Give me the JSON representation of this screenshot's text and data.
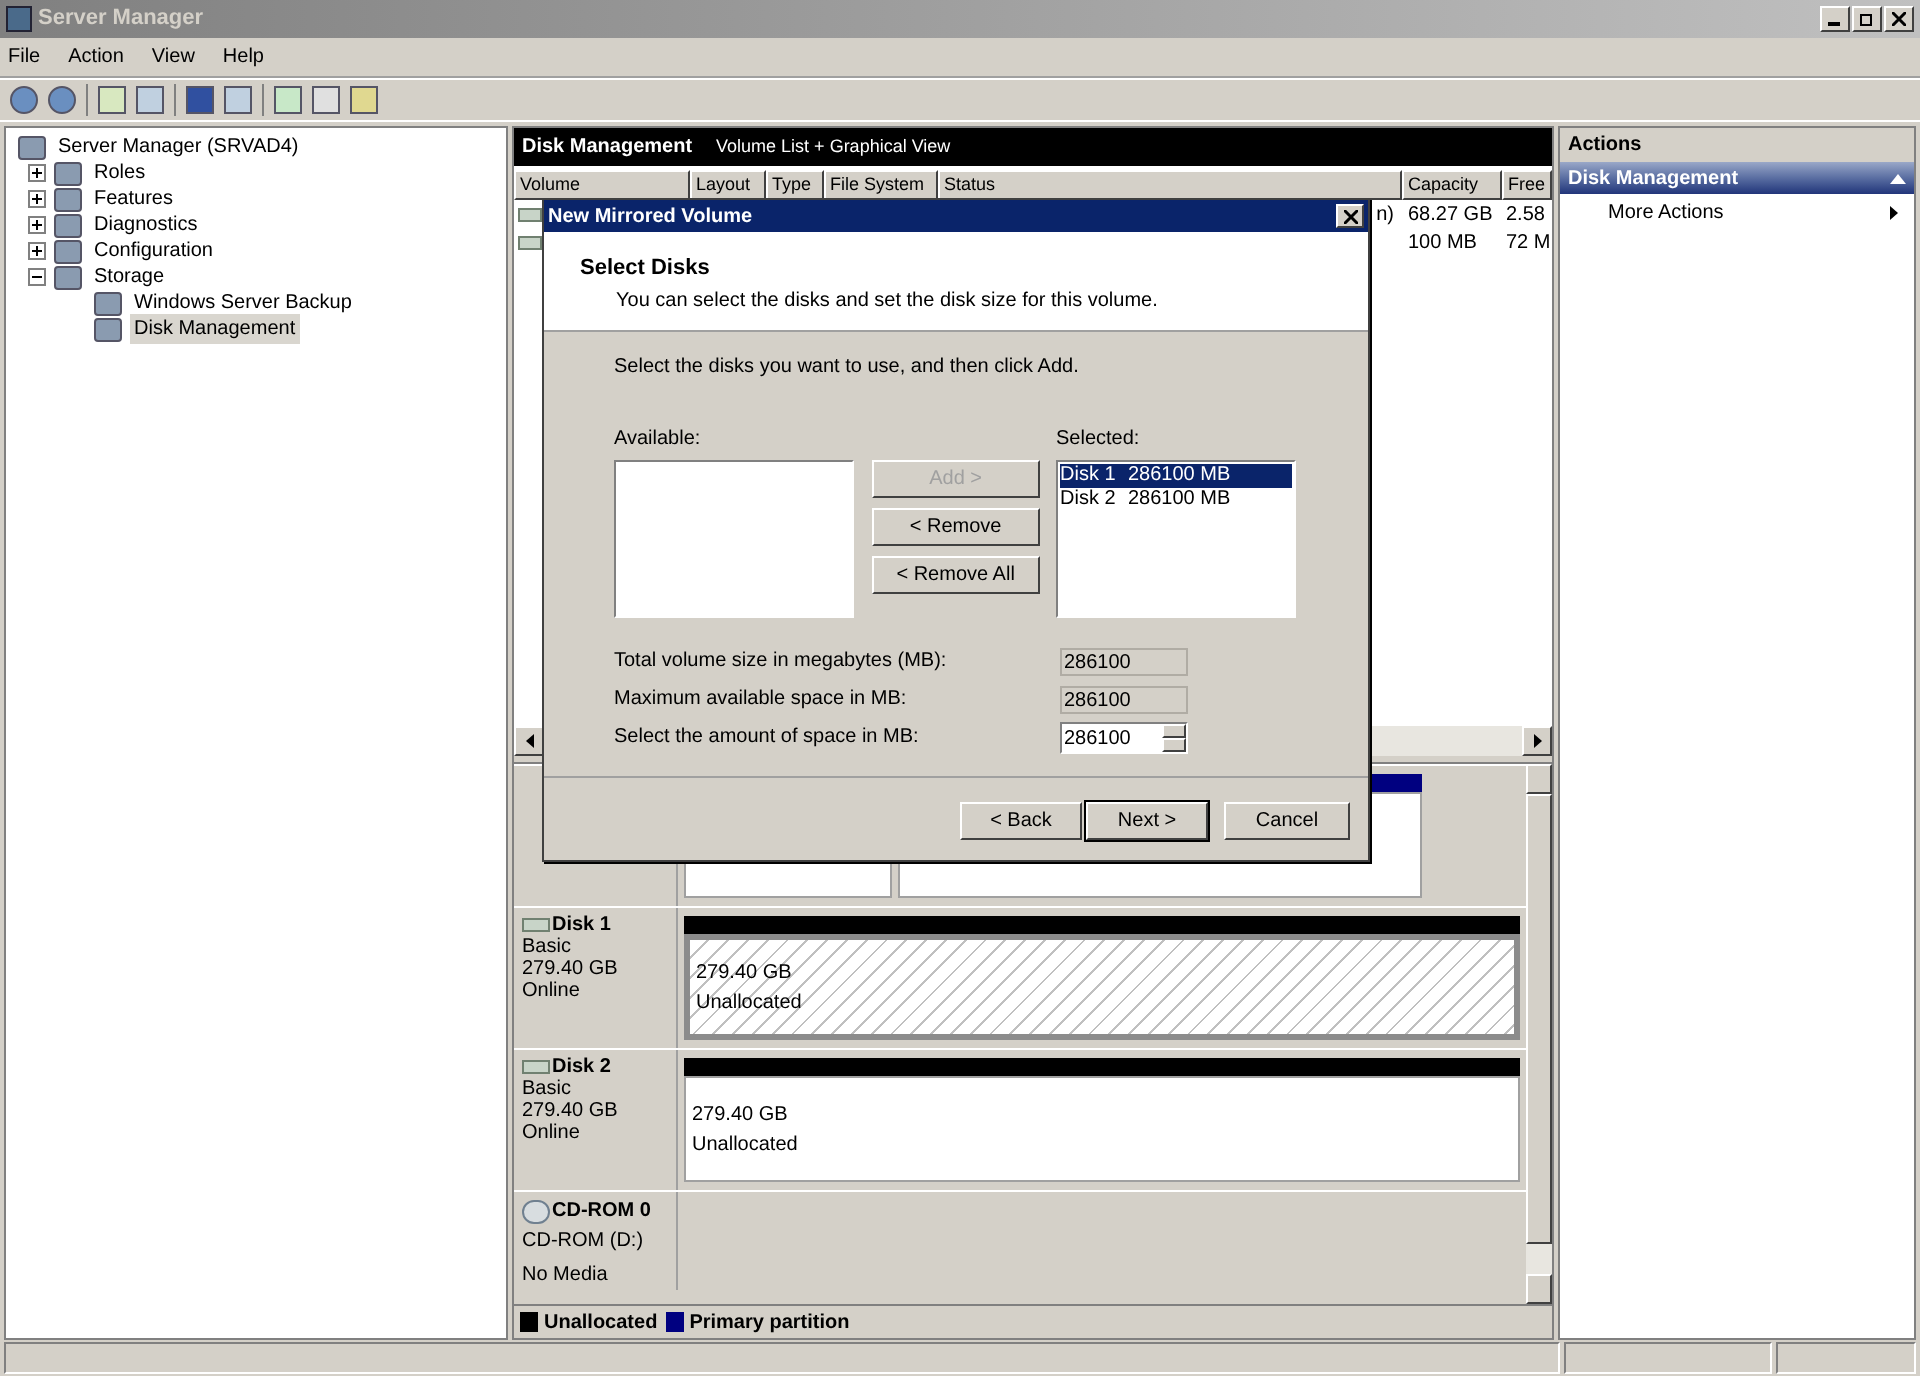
{
  "window": {
    "title": "Server Manager"
  },
  "menu": [
    {
      "label": "File"
    },
    {
      "label": "Action"
    },
    {
      "label": "View"
    },
    {
      "label": "Help"
    }
  ],
  "tree": [
    {
      "label": "Server Manager (SRVAD4)",
      "selected": false,
      "expanded": true,
      "children": [
        {
          "label": "Roles",
          "selected": false,
          "expanded": false
        },
        {
          "label": "Features",
          "selected": false,
          "expanded": false
        },
        {
          "label": "Diagnostics",
          "selected": false,
          "expanded": false
        },
        {
          "label": "Configuration",
          "selected": false,
          "expanded": false
        },
        {
          "label": "Storage",
          "selected": false,
          "expanded": true,
          "children": [
            {
              "label": "Windows Server Backup",
              "selected": false
            },
            {
              "label": "Disk Management",
              "selected": true
            }
          ]
        }
      ]
    }
  ],
  "content_header": {
    "title": "Disk Management",
    "view": "Volume List + Graphical View"
  },
  "volume_columns": [
    "Volume",
    "Layout",
    "Type",
    "File System",
    "Status",
    "Capacity",
    "Free"
  ],
  "volume_rows": [
    {
      "status": "n)",
      "capacity": "68.27 GB",
      "free": "2.58"
    },
    {
      "status": "",
      "capacity": "100 MB",
      "free": "72 M"
    }
  ],
  "disks": [
    {
      "kind": "disk",
      "partitions": [
        {
          "kind": "primary"
        },
        {
          "kind": "primary"
        }
      ]
    },
    {
      "kind": "disk",
      "name": "Disk 1",
      "type": "Basic",
      "size": "279.40 GB",
      "status": "Online",
      "partitions": [
        {
          "kind": "unallocated",
          "selected": true,
          "size": "279.40 GB",
          "label": "Unallocated"
        }
      ]
    },
    {
      "kind": "disk",
      "name": "Disk 2",
      "type": "Basic",
      "size": "279.40 GB",
      "status": "Online",
      "partitions": [
        {
          "kind": "unallocated",
          "selected": false,
          "size": "279.40 GB",
          "label": "Unallocated"
        }
      ]
    },
    {
      "kind": "cdrom",
      "name": "CD-ROM 0",
      "type": "CD-ROM (D:)",
      "status": "No Media"
    }
  ],
  "legend": [
    {
      "label": "Unallocated",
      "color": "#000000"
    },
    {
      "label": "Primary partition",
      "color": "#000080"
    }
  ],
  "actions": {
    "title": "Actions",
    "section": "Disk Management",
    "items": [
      {
        "label": "More Actions"
      }
    ]
  },
  "dialog": {
    "title": "New Mirrored Volume",
    "heading": "Select Disks",
    "subheading": "You can select the disks and set the disk size for this volume.",
    "instruction": "Select the disks you want to use, and then click Add.",
    "available_label": "Available:",
    "selected_label": "Selected:",
    "selected_disks": [
      {
        "disk": "Disk 1",
        "size": "286100 MB",
        "selected": true
      },
      {
        "disk": "Disk 2",
        "size": "286100 MB",
        "selected": false
      }
    ],
    "move_buttons": [
      {
        "label": "Add >",
        "disabled": true
      },
      {
        "label": "< Remove",
        "disabled": false
      },
      {
        "label": "< Remove All",
        "disabled": false
      }
    ],
    "fields": [
      {
        "kind": "readonly",
        "label": "Total volume size in megabytes (MB):",
        "value": "286100"
      },
      {
        "kind": "readonly",
        "label": "Maximum available space in MB:",
        "value": "286100"
      },
      {
        "kind": "spin",
        "label": "Select the amount of space in MB:",
        "value": "286100"
      }
    ],
    "buttons": [
      {
        "label": "< Back",
        "default": false
      },
      {
        "label": "Next >",
        "default": true
      },
      {
        "label": "Cancel",
        "default": false
      }
    ]
  }
}
